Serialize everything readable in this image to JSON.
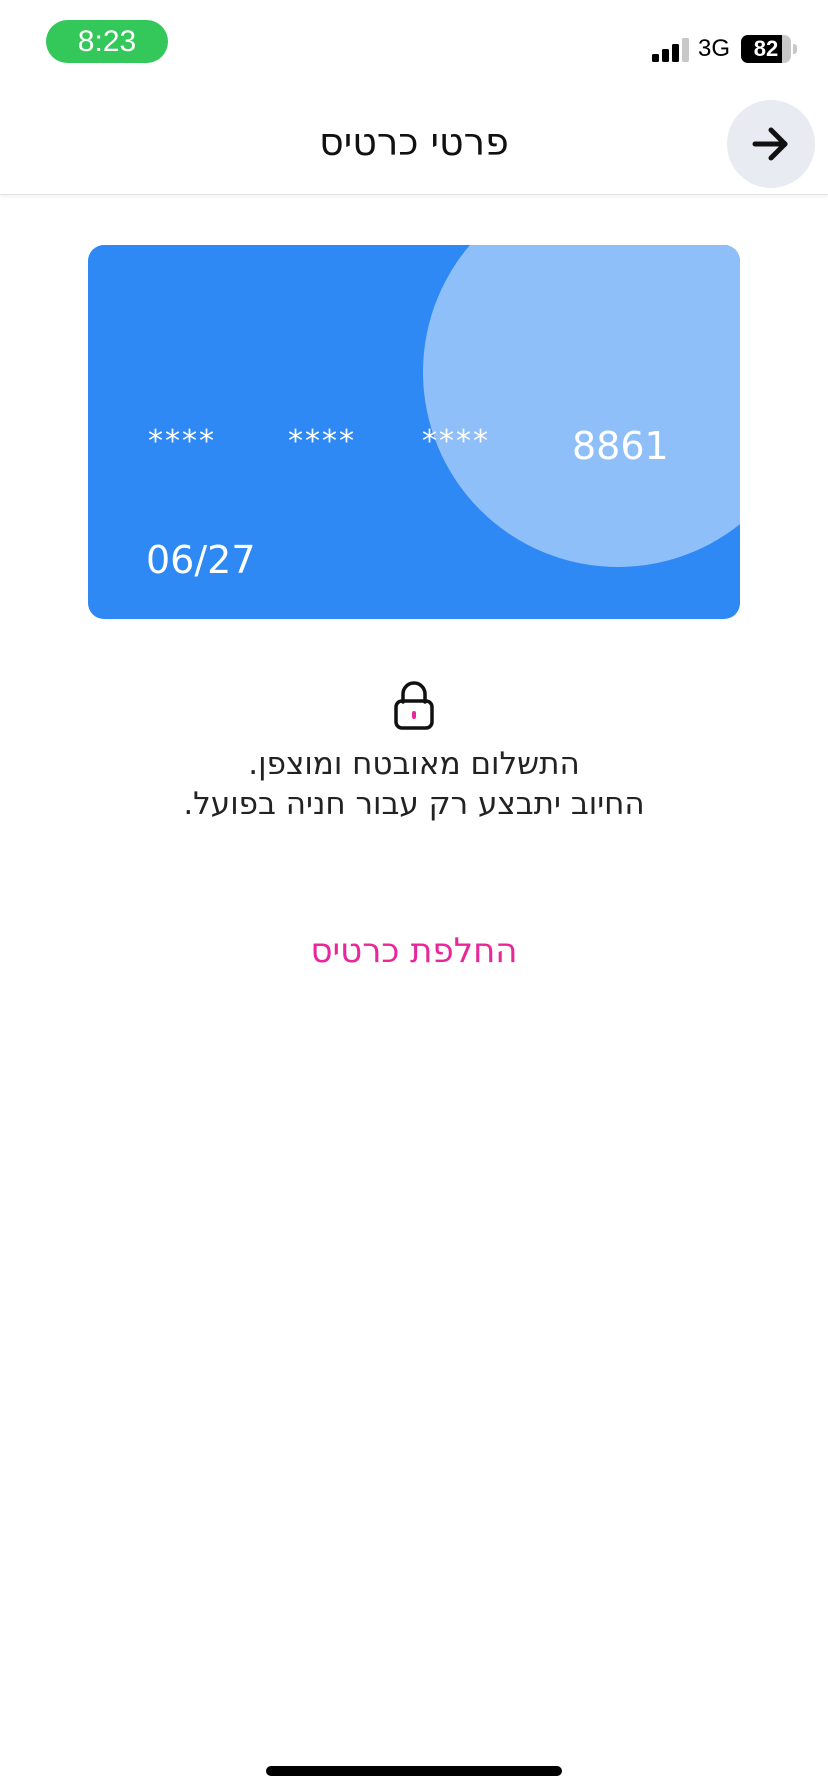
{
  "status_bar": {
    "time": "8:23",
    "network": "3G",
    "battery": "82",
    "battery_level": 0.82,
    "signal_bars_filled": 3,
    "signal_bars_total": 4
  },
  "header": {
    "title": "פרטי כרטיס",
    "back_icon": "arrow-right-icon"
  },
  "card": {
    "masked_groups": [
      "****",
      "****",
      "****"
    ],
    "last4": "8861",
    "expiry": "06/27",
    "color": "#2e89f5",
    "accent_color": "#8fbff8"
  },
  "security": {
    "icon": "lock-icon",
    "line1": "התשלום מאובטח ומוצפן.",
    "line2": "החיוב יתבצע רק עבור חניה בפועל."
  },
  "actions": {
    "change_card_label": "החלפת כרטיס",
    "change_card_color": "#e8289a"
  }
}
